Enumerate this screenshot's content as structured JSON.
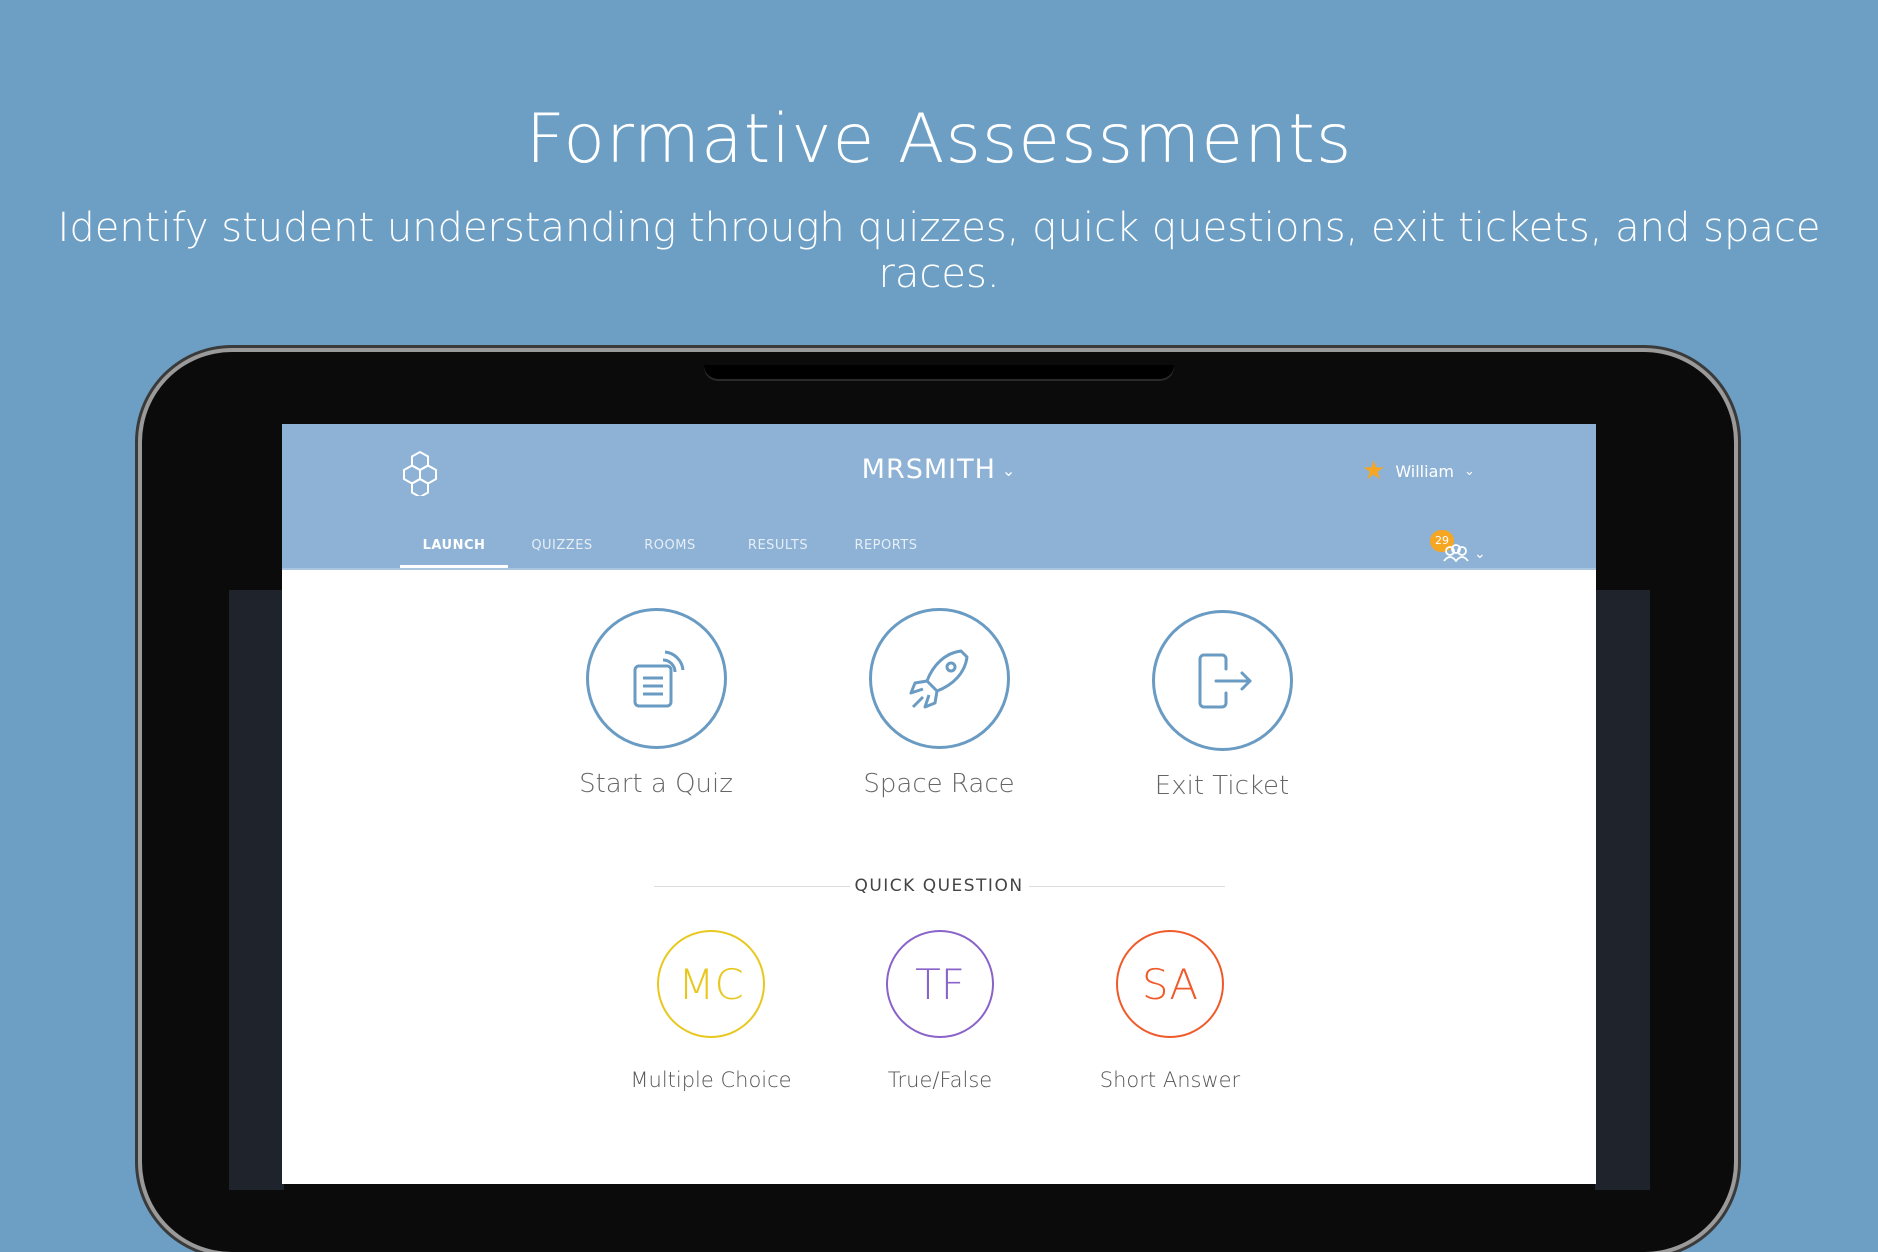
{
  "hero": {
    "title": "Formative Assessments",
    "subtitle": "Identify student understanding through quizzes, quick questions, exit tickets, and space races."
  },
  "header": {
    "class_name": "MRSMITH",
    "user_name": "William",
    "rooms_badge": "29"
  },
  "nav": {
    "tabs": [
      {
        "label": "LAUNCH",
        "active": true
      },
      {
        "label": "QUIZZES",
        "active": false
      },
      {
        "label": "ROOMS",
        "active": false
      },
      {
        "label": "RESULTS",
        "active": false
      },
      {
        "label": "REPORTS",
        "active": false
      }
    ]
  },
  "launch": {
    "items": [
      {
        "label": "Start a Quiz",
        "icon": "quiz-icon"
      },
      {
        "label": "Space Race",
        "icon": "rocket-icon"
      },
      {
        "label": "Exit Ticket",
        "icon": "exit-icon"
      }
    ]
  },
  "quick_question": {
    "title": "QUICK QUESTION",
    "items": [
      {
        "abbr": "MC",
        "label": "Multiple Choice",
        "color": "#e8c81e"
      },
      {
        "abbr": "TF",
        "label": "True/False",
        "color": "#8a63c9"
      },
      {
        "abbr": "SA",
        "label": "Short Answer",
        "color": "#f05a2a"
      }
    ]
  },
  "colors": {
    "background": "#6d9fc5",
    "header": "#8db2d5",
    "accent": "#6a9bc3",
    "star": "#f5a623"
  }
}
